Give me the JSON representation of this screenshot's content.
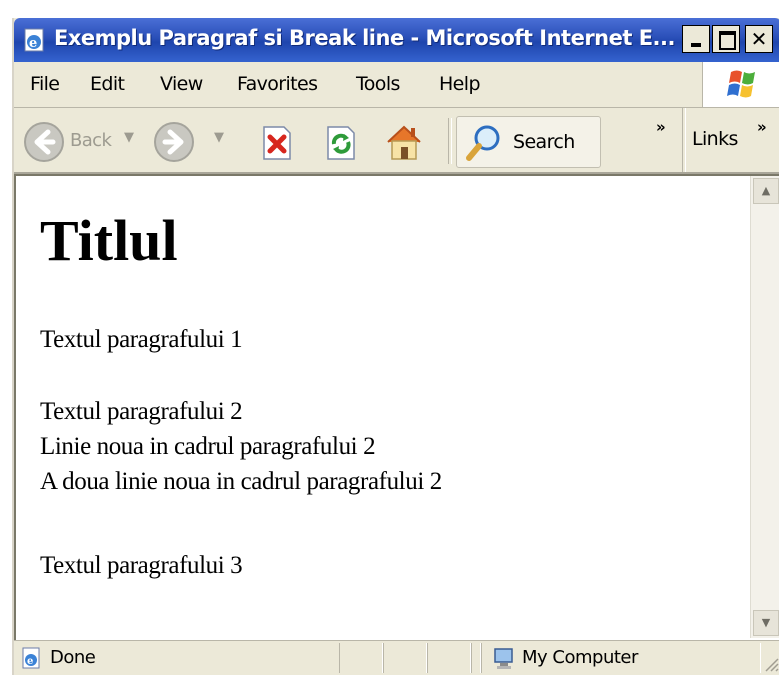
{
  "window": {
    "title": "Exemplu Paragraf si Break line - Microsoft Internet E...",
    "title_bar_color": "#2a4fb8"
  },
  "menu": {
    "items": [
      "File",
      "Edit",
      "View",
      "Favorites",
      "Tools",
      "Help"
    ]
  },
  "toolbar": {
    "back_label": "Back",
    "search_label": "Search",
    "links_label": "Links",
    "overflow_chevron": "»",
    "icons": [
      "back-arrow-icon",
      "forward-arrow-icon",
      "stop-icon",
      "refresh-icon",
      "home-icon",
      "search-icon"
    ]
  },
  "page": {
    "title": "Titlul",
    "paragraph_1": "Textul paragrafului 1",
    "paragraph_2_lines": [
      "Textul paragrafului 2",
      "Linie noua in cadrul paragrafului 2",
      "A doua linie noua in cadrul paragrafului 2"
    ],
    "paragraph_3": "Textul paragrafului 3"
  },
  "status": {
    "text": "Done",
    "zone": "My Computer"
  }
}
